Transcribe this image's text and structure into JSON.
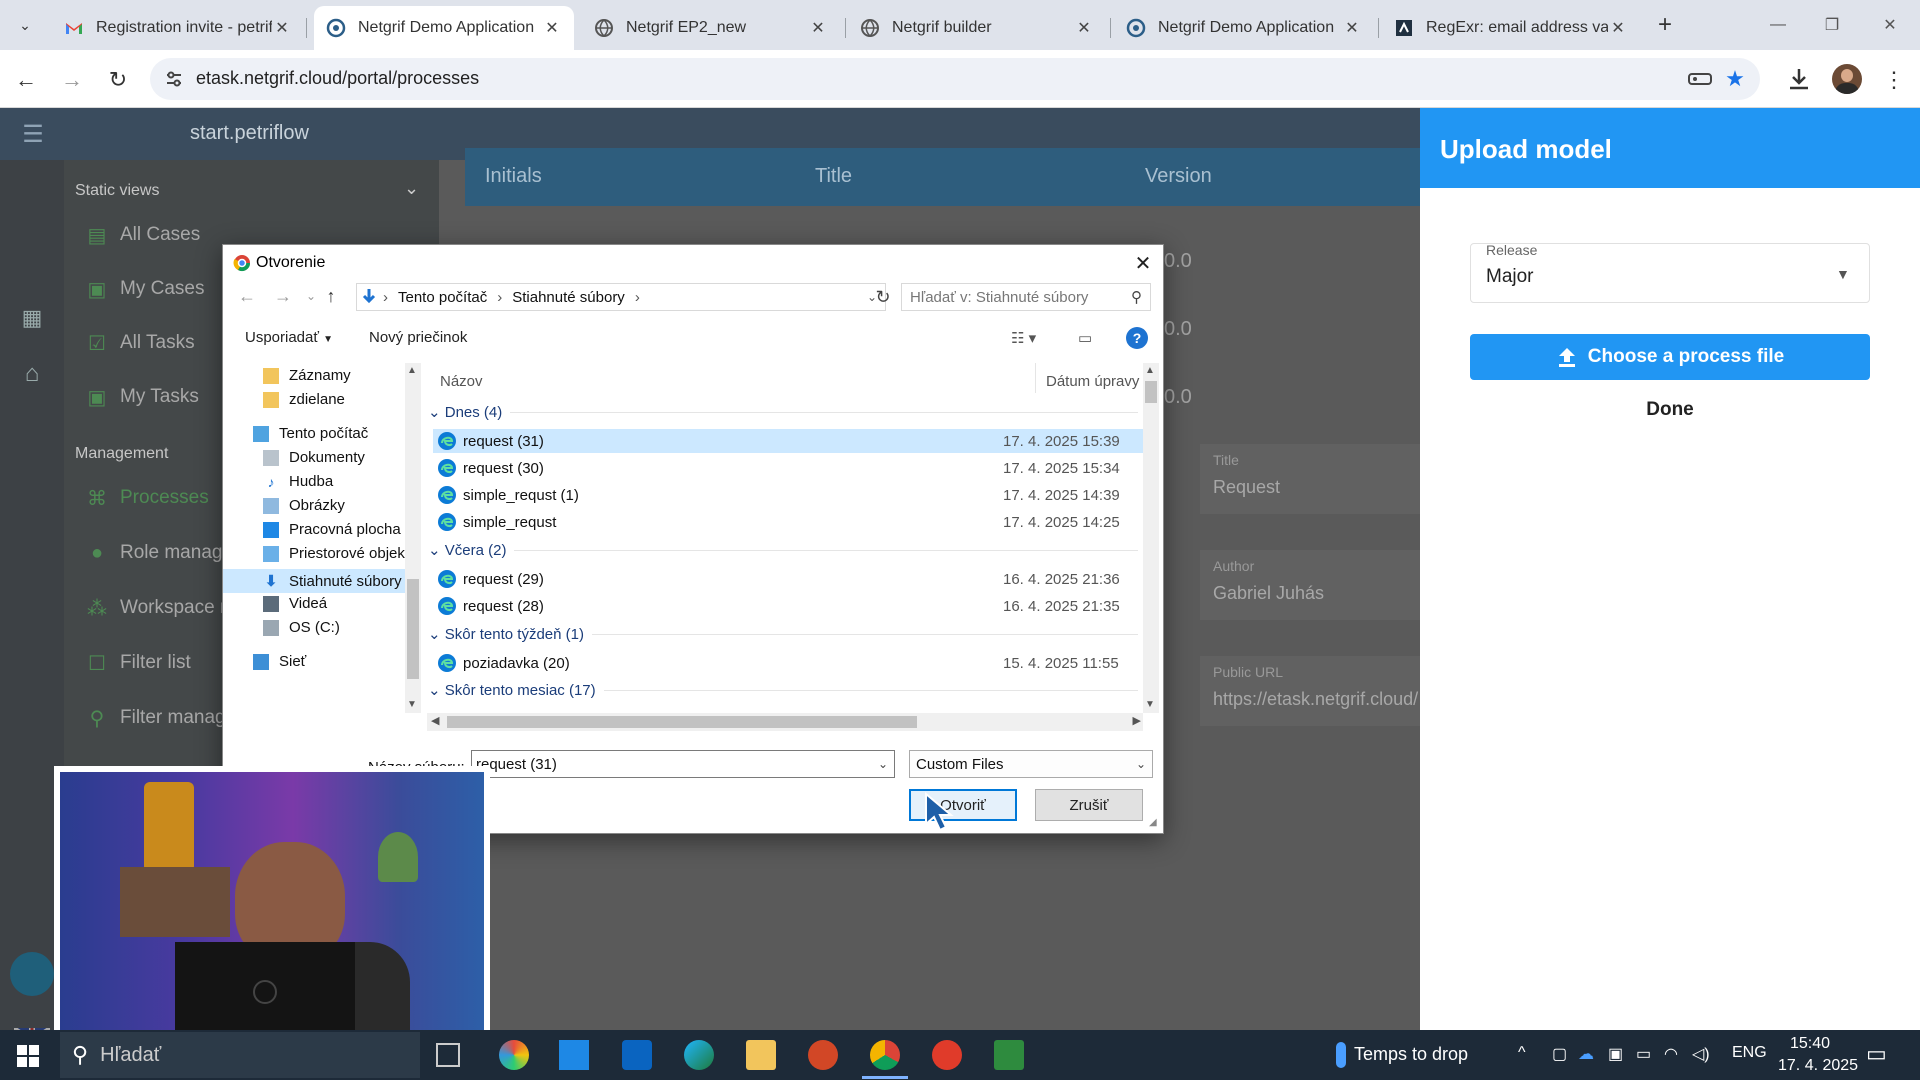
{
  "browser": {
    "tabs": [
      {
        "title": "Registration invite - petriflo",
        "favicon": "gmail-icon"
      },
      {
        "title": "Netgrif Demo Application",
        "favicon": "netgrif-icon",
        "active": true
      },
      {
        "title": "Netgrif EP2_new",
        "favicon": "globe-icon"
      },
      {
        "title": "Netgrif builder",
        "favicon": "globe-icon"
      },
      {
        "title": "Netgrif Demo Application",
        "favicon": "netgrif-icon"
      },
      {
        "title": "RegExr: email address valid",
        "favicon": "regexr-icon"
      }
    ],
    "new_tab": "+",
    "url": "etask.netgrif.cloud/portal/processes"
  },
  "app": {
    "title": "start.petriflow",
    "sidebar": {
      "static_header": "Static views",
      "static_items": [
        "All Cases",
        "My Cases",
        "All Tasks",
        "My Tasks"
      ],
      "management_header": "Management",
      "management_items": [
        "Processes",
        "Role manage",
        "Workspace m",
        "Filter list",
        "Filter manag"
      ]
    },
    "table": {
      "headers": [
        "Initials",
        "Title",
        "Version"
      ],
      "versions": [
        "0.0",
        "0.0",
        "0.0"
      ]
    },
    "details": {
      "title_label": "Title",
      "title_value": "Request",
      "author_label": "Author",
      "author_value": "Gabriel Juhás",
      "url_label": "Public URL",
      "url_value": "https://etask.netgrif.cloud/"
    }
  },
  "upload_panel": {
    "title": "Upload model",
    "release_label": "Release",
    "release_value": "Major",
    "choose_button": "Choose a process file",
    "done_button": "Done"
  },
  "dialog": {
    "title": "Otvorenie",
    "breadcrumb": [
      "Tento počítač",
      "Stiahnuté súbory"
    ],
    "search_placeholder": "Hľadať v: Stiahnuté súbory",
    "organize": "Usporiadať",
    "new_folder": "Nový priečinok",
    "tree": [
      {
        "label": "Záznamy",
        "kind": "folder"
      },
      {
        "label": "zdielane",
        "kind": "folder"
      },
      {
        "label": "Tento počítač",
        "kind": "pc"
      },
      {
        "label": "Dokumenty",
        "kind": "docs"
      },
      {
        "label": "Hudba",
        "kind": "music"
      },
      {
        "label": "Obrázky",
        "kind": "pictures"
      },
      {
        "label": "Pracovná plocha",
        "kind": "desktop"
      },
      {
        "label": "Priestorové objek",
        "kind": "3d"
      },
      {
        "label": "Stiahnuté súbory",
        "kind": "download",
        "selected": true
      },
      {
        "label": "Videá",
        "kind": "video"
      },
      {
        "label": "OS (C:)",
        "kind": "drive"
      },
      {
        "label": "Sieť",
        "kind": "network"
      }
    ],
    "col_name": "Názov",
    "col_date": "Dátum úpravy",
    "groups": [
      {
        "label": "Dnes (4)",
        "files": [
          {
            "name": "request (31)",
            "date": "17. 4. 2025 15:39",
            "selected": true
          },
          {
            "name": "request (30)",
            "date": "17. 4. 2025 15:34"
          },
          {
            "name": "simple_requst (1)",
            "date": "17. 4. 2025 14:39"
          },
          {
            "name": "simple_requst",
            "date": "17. 4. 2025 14:25"
          }
        ]
      },
      {
        "label": "Včera (2)",
        "files": [
          {
            "name": "request (29)",
            "date": "16. 4. 2025 21:36"
          },
          {
            "name": "request (28)",
            "date": "16. 4. 2025 21:35"
          }
        ]
      },
      {
        "label": "Skôr tento týždeň (1)",
        "files": [
          {
            "name": "poziadavka (20)",
            "date": "15. 4. 2025 11:55"
          }
        ]
      },
      {
        "label": "Skôr tento mesiac (17)",
        "files": []
      }
    ],
    "filename_label": "Názov súboru:",
    "filename_value": "request (31)",
    "filetype_value": "Custom Files",
    "open_button": "Otvoriť",
    "cancel_button": "Zrušiť"
  },
  "taskbar": {
    "search_placeholder": "Hľadať",
    "weather": "Temps to drop",
    "lang": "ENG",
    "time": "15:40",
    "date": "17. 4. 2025"
  },
  "colors": {
    "accent": "#2196f3",
    "selection": "#cce8ff",
    "netgrif_green": "#4d8a53"
  }
}
